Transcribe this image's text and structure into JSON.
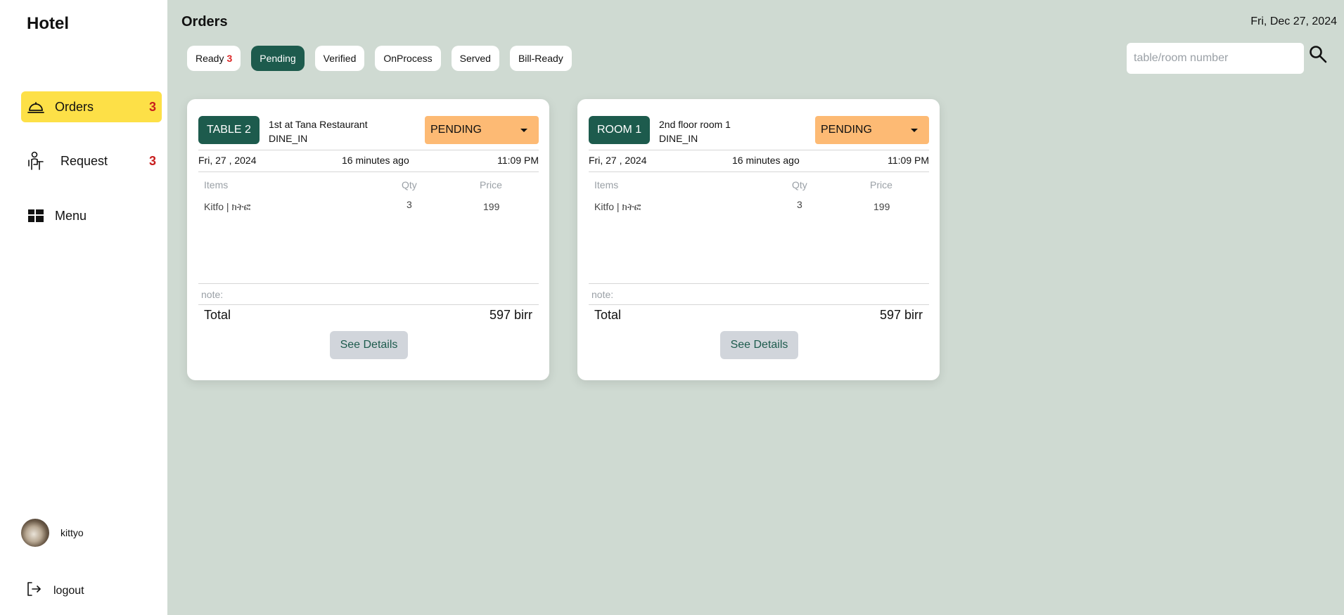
{
  "app": {
    "brand": "Hotel"
  },
  "sidebar": {
    "items": [
      {
        "label": "Orders",
        "count": "3",
        "icon": "service-bell-icon",
        "active": true
      },
      {
        "label": "Request",
        "count": "3",
        "icon": "waiter-icon",
        "active": false
      },
      {
        "label": "Menu",
        "icon": "dashboard-grid-icon",
        "active": false
      }
    ],
    "user": {
      "name": "kittyo",
      "avatar": "cat-avatar"
    },
    "logout_label": "logout"
  },
  "header": {
    "title": "Orders",
    "date": "Fri, Dec 27, 2024"
  },
  "tabs": [
    {
      "label": "Ready",
      "badge": "3",
      "active": false
    },
    {
      "label": "Pending",
      "active": true
    },
    {
      "label": "Verified",
      "active": false
    },
    {
      "label": "OnProcess",
      "active": false
    },
    {
      "label": "Served",
      "active": false
    },
    {
      "label": "Bill-Ready",
      "active": false
    }
  ],
  "search": {
    "placeholder": "table/room number",
    "value": "",
    "icon": "search-icon"
  },
  "colors": {
    "accent": "#1d5b4d",
    "active_nav": "#fde047",
    "status_pending": "#fdba74",
    "count_red": "#c81e1e",
    "background": "#cfdad2"
  },
  "orders": [
    {
      "label": "TABLE 2",
      "location": "1st at Tana Restaurant",
      "service": "DINE_IN",
      "status": "PENDING",
      "date": "Fri, 27 , 2024",
      "elapsed": "16 minutes ago",
      "time": "11:09 PM",
      "columns": {
        "items": "Items",
        "qty": "Qty",
        "price": "Price"
      },
      "items": [
        {
          "name": "Kitfo | ክትፎ",
          "qty": "3",
          "price": "199"
        }
      ],
      "note_label": "note:",
      "total_label": "Total",
      "total_value": "597 birr",
      "details_label": "See Details"
    },
    {
      "label": "ROOM 1",
      "location": "2nd floor room 1",
      "service": "DINE_IN",
      "status": "PENDING",
      "date": "Fri, 27 , 2024",
      "elapsed": "16 minutes ago",
      "time": "11:09 PM",
      "columns": {
        "items": "Items",
        "qty": "Qty",
        "price": "Price"
      },
      "items": [
        {
          "name": "Kitfo | ክትፎ",
          "qty": "3",
          "price": "199"
        }
      ],
      "note_label": "note:",
      "total_label": "Total",
      "total_value": "597 birr",
      "details_label": "See Details"
    }
  ]
}
